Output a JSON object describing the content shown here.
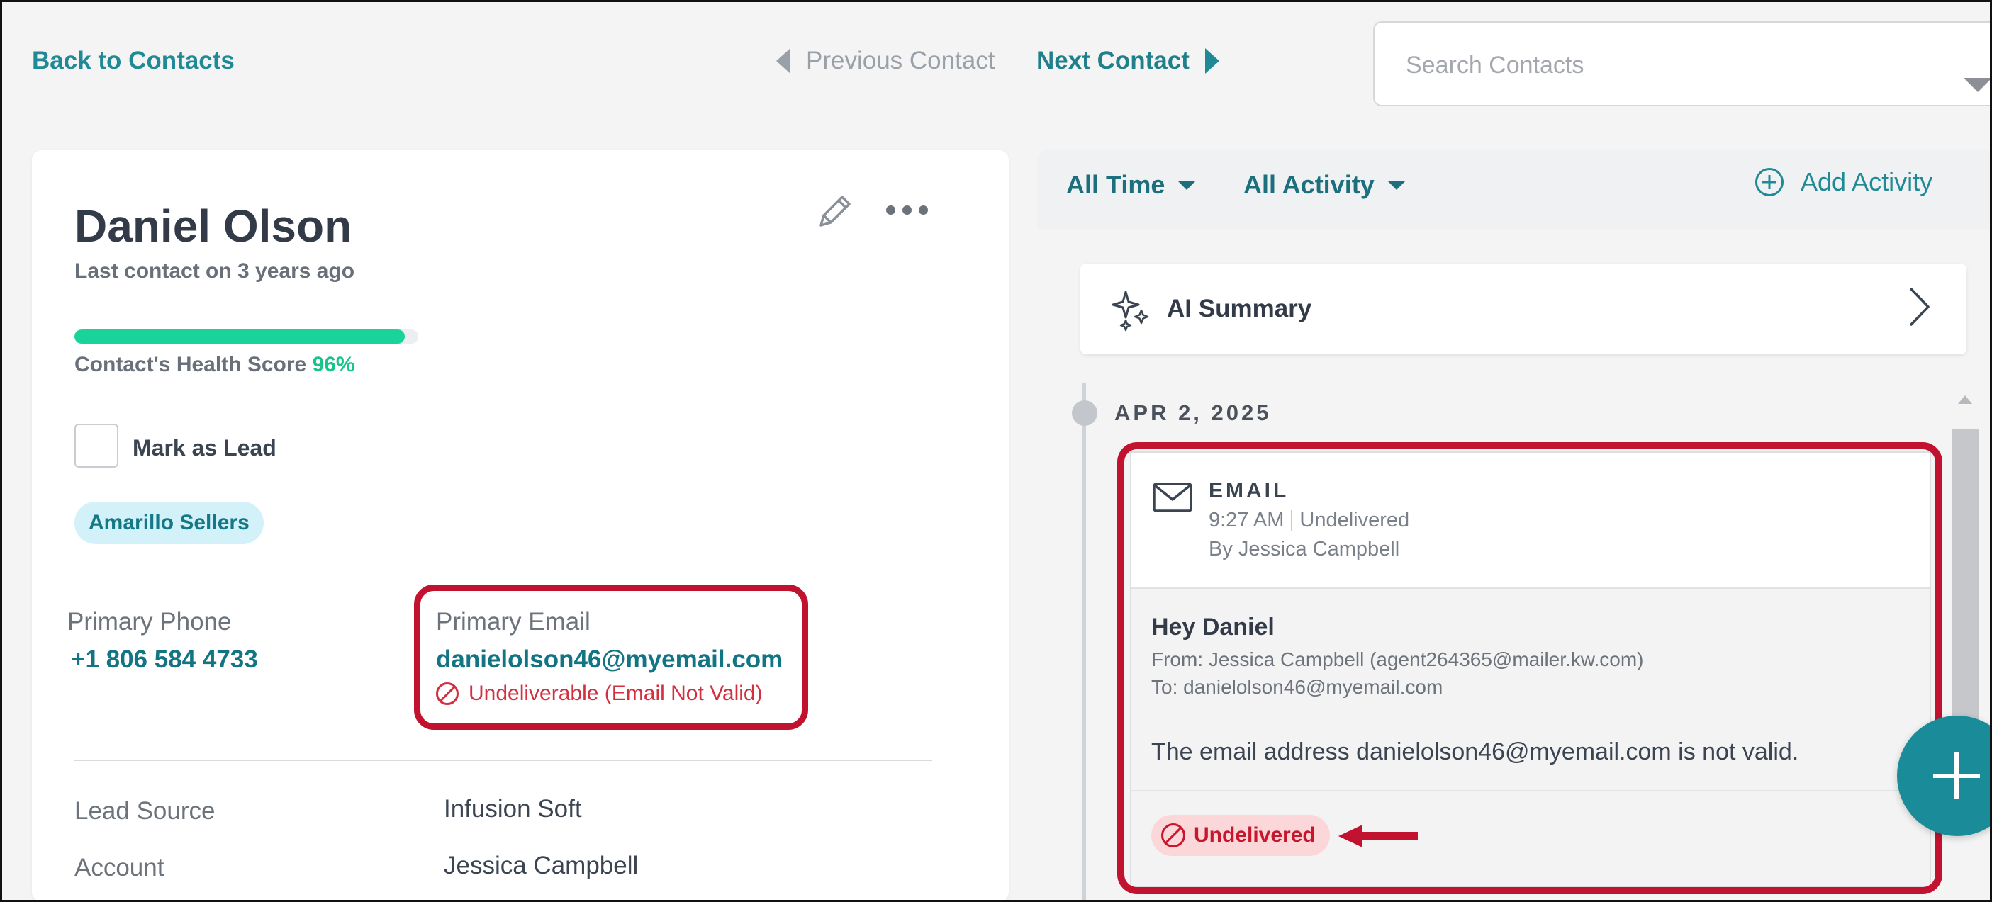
{
  "nav": {
    "back_label": "Back to Contacts",
    "previous_label": "Previous Contact",
    "next_label": "Next Contact"
  },
  "search": {
    "placeholder": "Search Contacts",
    "value": ""
  },
  "contact": {
    "name": "Daniel Olson",
    "last_contact": "Last contact on 3 years ago",
    "health_label": "Contact's Health Score",
    "health_value": "96%",
    "health_fraction": 0.96,
    "mark_lead_label": "Mark as Lead",
    "mark_lead_checked": false,
    "tag": "Amarillo Sellers",
    "phone_label": "Primary Phone",
    "phone_value": "+1 806 584 4733",
    "email_label": "Primary Email",
    "email_value": "danielolson46@myemail.com",
    "email_status": "Undeliverable (Email Not Valid)",
    "lead_source_label": "Lead Source",
    "lead_source_value": "Infusion Soft",
    "account_label": "Account",
    "account_value": "Jessica Campbell"
  },
  "activity": {
    "filter_time": "All Time",
    "filter_activity": "All Activity",
    "add_label": "Add Activity",
    "ai_summary_label": "AI Summary",
    "date": "APR 2, 2025",
    "email": {
      "type": "EMAIL",
      "time": "9:27 AM",
      "status": "Undelivered",
      "by": "By Jessica Campbell",
      "subject": "Hey Daniel",
      "from": "From: Jessica Campbell (agent264365@mailer.kw.com)",
      "to": "To: danielolson46@myemail.com",
      "message": "The email address danielolson46@myemail.com is not valid.",
      "badge": "Undelivered"
    }
  },
  "colors": {
    "accent": "#1f8a96",
    "health": "#19d39a",
    "error": "#d32f3f",
    "highlight": "#c1122f"
  }
}
